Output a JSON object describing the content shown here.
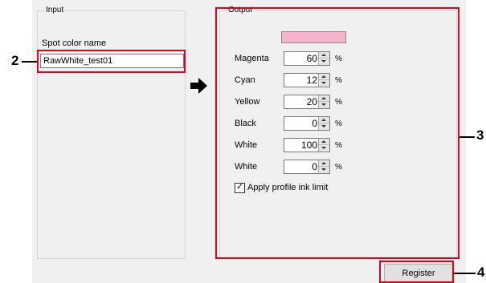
{
  "input_group": {
    "title": "Input",
    "spot_color_label": "Spot color name",
    "spot_color_value": "RawWhite_test01"
  },
  "output_group": {
    "title": "Output",
    "swatch_color": "#f5b4cb",
    "rows": [
      {
        "label": "Magenta",
        "value": "60",
        "unit": "%"
      },
      {
        "label": "Cyan",
        "value": "12",
        "unit": "%"
      },
      {
        "label": "Yellow",
        "value": "20",
        "unit": "%"
      },
      {
        "label": "Black",
        "value": "0",
        "unit": "%"
      },
      {
        "label": "White",
        "value": "100",
        "unit": "%"
      },
      {
        "label": "White",
        "value": "0",
        "unit": "%"
      }
    ],
    "checkbox_label": "Apply profile ink limit",
    "checkbox_checked": true
  },
  "buttons": {
    "register": "Register"
  },
  "callouts": {
    "n2": "2",
    "n3": "3",
    "n4": "4"
  },
  "colors": {
    "callout_red": "#e60012",
    "swatch": "#f5b4cb"
  }
}
